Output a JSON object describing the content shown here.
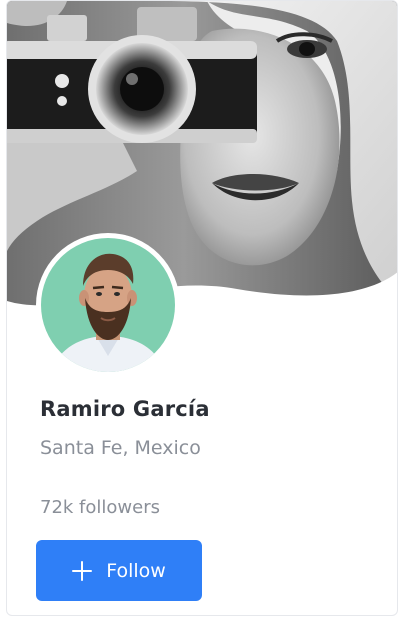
{
  "profile": {
    "name": "Ramiro García",
    "location": "Santa Fe, Mexico",
    "followers": "72k followers"
  },
  "actions": {
    "follow_label": "Follow",
    "follow_icon": "plus-icon"
  },
  "colors": {
    "accent": "#2f7ff7",
    "avatar_background": "#7fcfb0",
    "name_text": "#2b2f36",
    "muted_text": "#8a8f98"
  },
  "media": {
    "cover": "black-and-white photo of a woman holding a camera",
    "avatar": "bearded man on mint background"
  }
}
